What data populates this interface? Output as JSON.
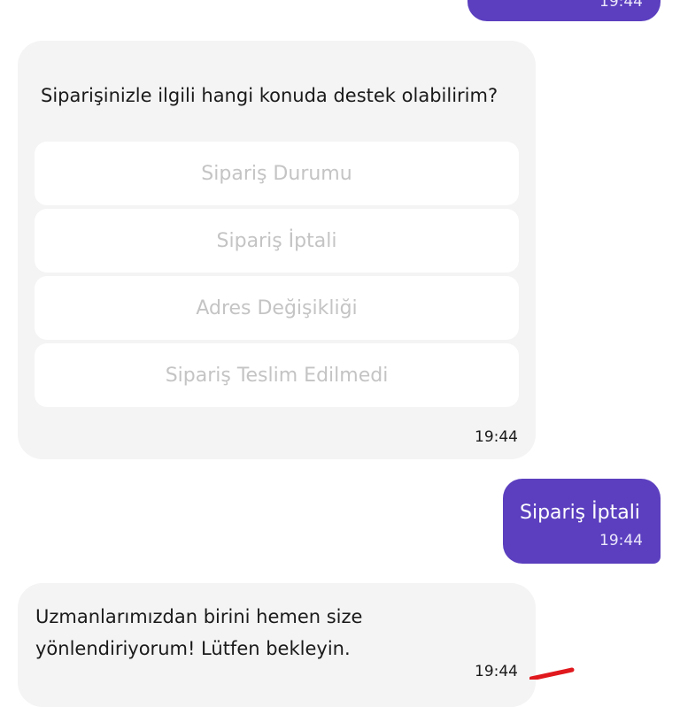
{
  "messages": {
    "top_outgoing": {
      "time": "19:44"
    },
    "question": {
      "text": "Siparişinizle ilgili hangi konuda destek olabilirim?",
      "options": [
        "Sipariş Durumu",
        "Sipariş İptali",
        "Adres Değişikliği",
        "Sipariş Teslim Edilmedi"
      ],
      "time": "19:44"
    },
    "choice": {
      "text": "Sipariş İptali",
      "time": "19:44"
    },
    "reply": {
      "text": "Uzmanlarımızdan birini hemen size yönlendiriyorum! Lütfen bekleyin.",
      "time": "19:44"
    }
  },
  "colors": {
    "outgoing_bubble": "#5b3fbf",
    "incoming_bubble": "#f4f4f4",
    "option_text_disabled": "#c4c4c4",
    "annotation_mark": "#e0191e"
  }
}
